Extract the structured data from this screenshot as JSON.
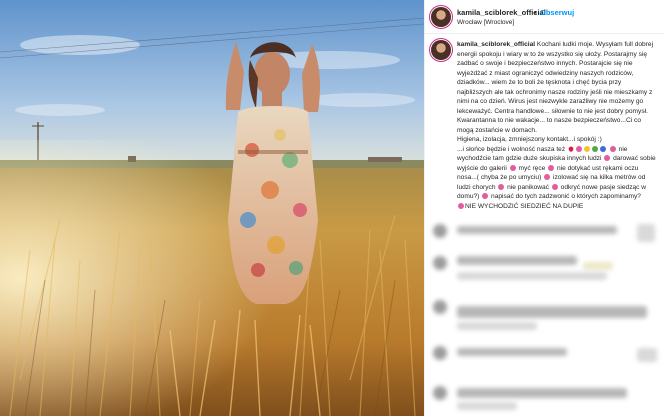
{
  "post": {
    "username": "kamila_sciblorek_official",
    "dot": "•",
    "follow_label": "Obserwuj",
    "location": "Wrocław [Wroclove]"
  },
  "caption": {
    "username": "kamila_sciblorek_official",
    "line1": "Kochani ludki moje. Wysyłam full dobrej energii spokoju i wiary w to że wszystko się ułoży. Postarajmy się zadbać o swoje i bezpieczeństwo innych. Postarajcie się nie wyjeżdżać z miast ograniczyć odwiedziny naszych rodziców, dziadków... wiem że to boli że tęsknota i chęć bycia przy najbliższych ale tak ochronimy nasze rodziny jeśli nie mieszkamy z nimi na co dzień. Wirus jest niezwykle zaraźliwy nie możemy go lekceważyć. Centra handlowe... siłownie to nie jest dobry pomysł. Kwarantanna to nie wakacje... to nasze bezpieczeństwo...Ci co mogą zostańcie w domach.",
    "line2": "Higiena, izolacja, zmniejszony kontakt...i spokój :)",
    "line3_a": "...i słońce będzie i wolność nasza też",
    "line3_b": "nie wychodźcie tam gdzie duże skupiska innych ludzi",
    "line3_c": "darować sobie wyjście do galerii",
    "line3_d": "myć ręce",
    "line3_e": "nie dotykać ust rękami oczu nosa...( chyba że po umyciu)",
    "line3_f": "izolować się na kilka metrów od ludzi chorych",
    "line3_g": "nie panikować",
    "line3_h": "odkryć nowe pasje siedząc w domu?)",
    "line3_i": "napisać do tych zadzwonić o których zapominamy?",
    "line4": "NIE WYCHODZIĆ SIEDZIEĆ NA DUPIE"
  },
  "icons": {
    "avatar": "profile-avatar-icon",
    "emoji_pink": "flower-emoji-icon",
    "emoji_heart": "heart-emoji-icon"
  },
  "colors": {
    "follow": "#0095f6",
    "avatar_ring": "#c72e8c",
    "sky": "#7aa5cf",
    "wheat": "#c98a3a"
  }
}
